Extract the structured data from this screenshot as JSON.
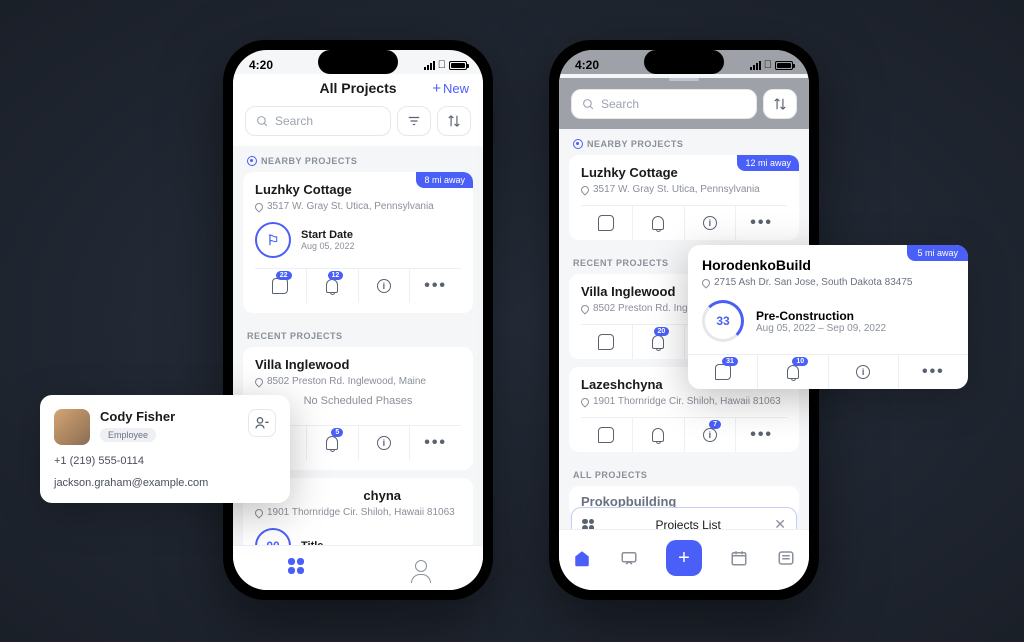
{
  "status": {
    "time": "4:20"
  },
  "left": {
    "header": {
      "title": "All Projects",
      "new": "New"
    },
    "search": {
      "placeholder": "Search"
    },
    "sections": {
      "nearby": "NEARBY PROJECTS",
      "recent": "RECENT PROJECTS"
    },
    "nearby": {
      "title": "Luzhky Cottage",
      "address": "3517 W. Gray St. Utica, Pennsylvania",
      "distance": "8 mi away",
      "phase": {
        "title": "Start Date",
        "date": "Aug 05, 2022"
      },
      "badges": {
        "chat": "22",
        "bell": "12"
      }
    },
    "recent1": {
      "title": "Villa Inglewood",
      "address": "8502 Preston Rd. Inglewood, Maine",
      "noPhase": "No Scheduled Phases",
      "badges": {
        "bell": "5"
      }
    },
    "recent2": {
      "title_suffix": "chyna",
      "address": "1901 Thornridge Cir. Shiloh, Hawaii 81063",
      "phase": {
        "num": "00",
        "title": "Title"
      }
    }
  },
  "right": {
    "search": {
      "placeholder": "Search"
    },
    "sections": {
      "nearby": "NEARBY PROJECTS",
      "recent": "RECENT PROJECTS",
      "all": "ALL PROJECTS"
    },
    "nearby": {
      "title": "Luzhky Cottage",
      "address": "3517 W. Gray St. Utica, Pennsylvania",
      "distance": "12 mi away"
    },
    "recent1": {
      "title": "Villa Inglewood",
      "address": "8502 Preston Rd. Inglewood",
      "badges": {
        "bell": "20"
      }
    },
    "recent2": {
      "title": "Lazeshchyna",
      "address": "1901 Thornridge Cir. Shiloh, Hawaii 81063",
      "badges": {
        "info": "7"
      }
    },
    "all1": {
      "title": "Prokopbuilding"
    },
    "pill": "Projects List"
  },
  "contactCard": {
    "name": "Cody Fisher",
    "role": "Employee",
    "phone": "+1 (219) 555-0114",
    "email": "jackson.graham@example.com"
  },
  "projectCard": {
    "title": "HorodenkoBuild",
    "distance": "5 mi away",
    "address": "2715 Ash Dr. San Jose, South Dakota 83475",
    "progress": "33",
    "phaseTitle": "Pre-Construction",
    "phaseDate": "Aug 05, 2022 – Sep 09, 2022",
    "badges": {
      "chat": "31",
      "bell": "10"
    }
  },
  "colors": {
    "accent": "#4a5ff7"
  }
}
